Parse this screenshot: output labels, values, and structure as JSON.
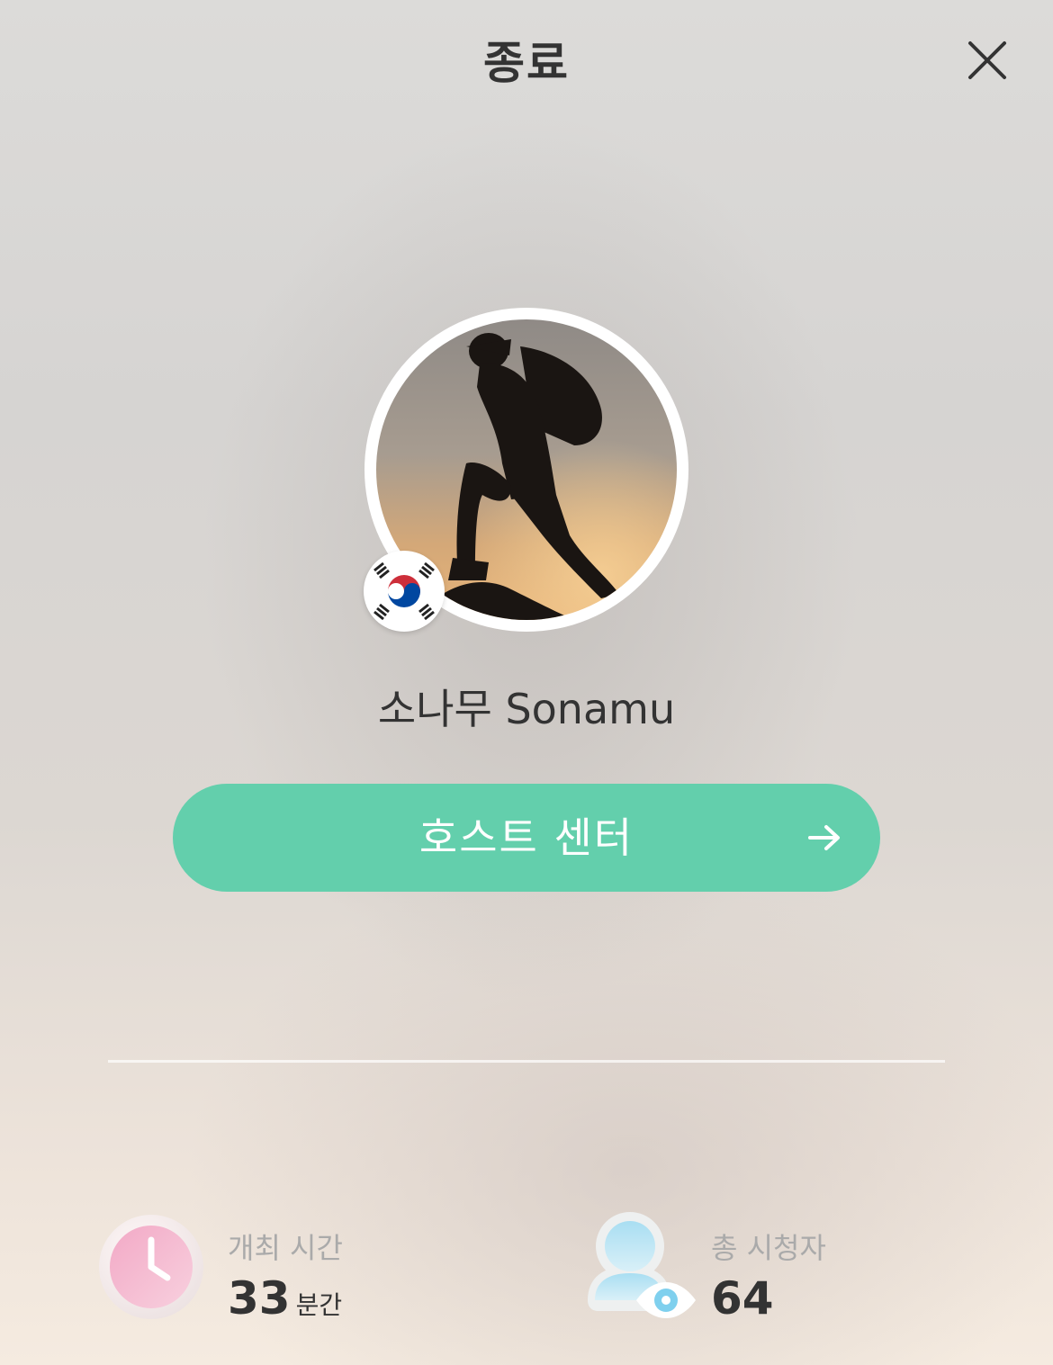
{
  "header": {
    "title": "종료",
    "close_icon": "close-icon"
  },
  "profile": {
    "name": "소나무 Sonamu",
    "avatar": "hiker-silhouette-photo",
    "flag": "south-korea-flag"
  },
  "host_center": {
    "label": "호스트 센터",
    "icon": "arrow-right-icon",
    "color": "#63cfac"
  },
  "stats": {
    "duration": {
      "label": "개최 시간",
      "value": "33",
      "unit": "분간",
      "icon": "clock-icon"
    },
    "viewers": {
      "label": "총 시청자",
      "value": "64",
      "icon": "viewer-eye-icon"
    }
  }
}
